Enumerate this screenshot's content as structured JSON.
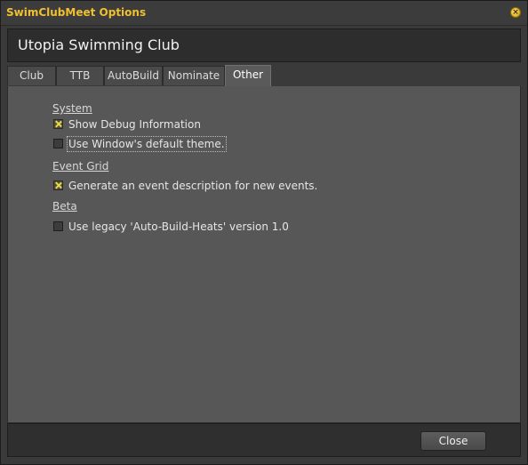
{
  "window": {
    "title": "SwimClubMeet Options",
    "close_glyph": "×"
  },
  "header": {
    "club_name": "Utopia Swimming Club"
  },
  "tabs": [
    {
      "label": "Club",
      "active": false
    },
    {
      "label": "TTB",
      "active": false
    },
    {
      "label": "AutoBuild",
      "active": false
    },
    {
      "label": "Nominate",
      "active": false
    },
    {
      "label": "Other",
      "active": true
    }
  ],
  "sections": {
    "system": {
      "title": "System",
      "options": [
        {
          "label": "Show Debug Information",
          "checked": true
        },
        {
          "label": "Use Window's default theme.",
          "checked": false
        }
      ]
    },
    "event_grid": {
      "title": "Event Grid",
      "options": [
        {
          "label": "Generate an event description for new events.",
          "checked": true
        }
      ]
    },
    "beta": {
      "title": "Beta",
      "options": [
        {
          "label": "Use legacy 'Auto-Build-Heats' version 1.0",
          "checked": false
        }
      ]
    }
  },
  "footer": {
    "close_label": "Close"
  },
  "colors": {
    "title_accent": "#f0c030",
    "check_mark": "#e8d84a"
  }
}
